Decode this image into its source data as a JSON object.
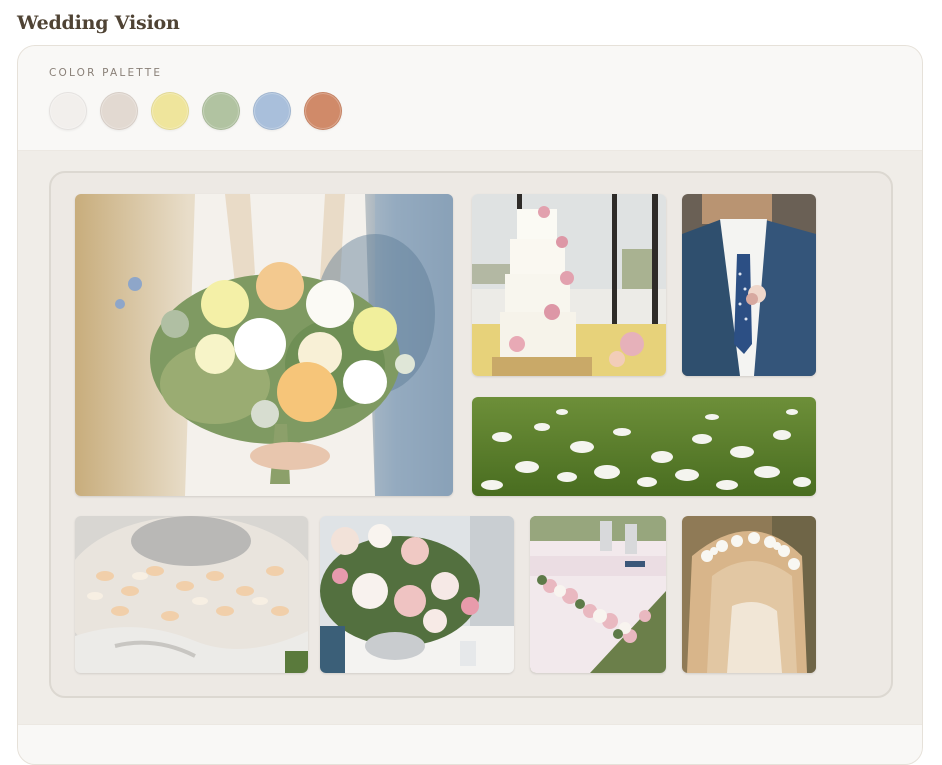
{
  "page": {
    "title": "Wedding Vision"
  },
  "palette": {
    "label": "COLOR PALETTE",
    "colors": [
      "#f2efec",
      "#e2d9d1",
      "#efe59c",
      "#b1c3a1",
      "#a9bfdb",
      "#d08a69"
    ]
  },
  "gallery": {
    "photos": [
      {
        "name": "bridal-bouquet-photo",
        "subject": "bride holding pastel bouquet"
      },
      {
        "name": "wedding-cake-photo",
        "subject": "tiered white cake with pink roses"
      },
      {
        "name": "groom-boutonniere-photo",
        "subject": "groom in navy suit with boutonniere"
      },
      {
        "name": "petal-lawn-photo",
        "subject": "white petals on green grass"
      },
      {
        "name": "petal-fountain-photo",
        "subject": "fountain filled with peach petals"
      },
      {
        "name": "centerpiece-photo",
        "subject": "pink and white floral centerpiece"
      },
      {
        "name": "reception-table-photo",
        "subject": "reception table with floral garland"
      },
      {
        "name": "flower-girl-photo",
        "subject": "flower girl with baby's breath crown"
      }
    ]
  }
}
